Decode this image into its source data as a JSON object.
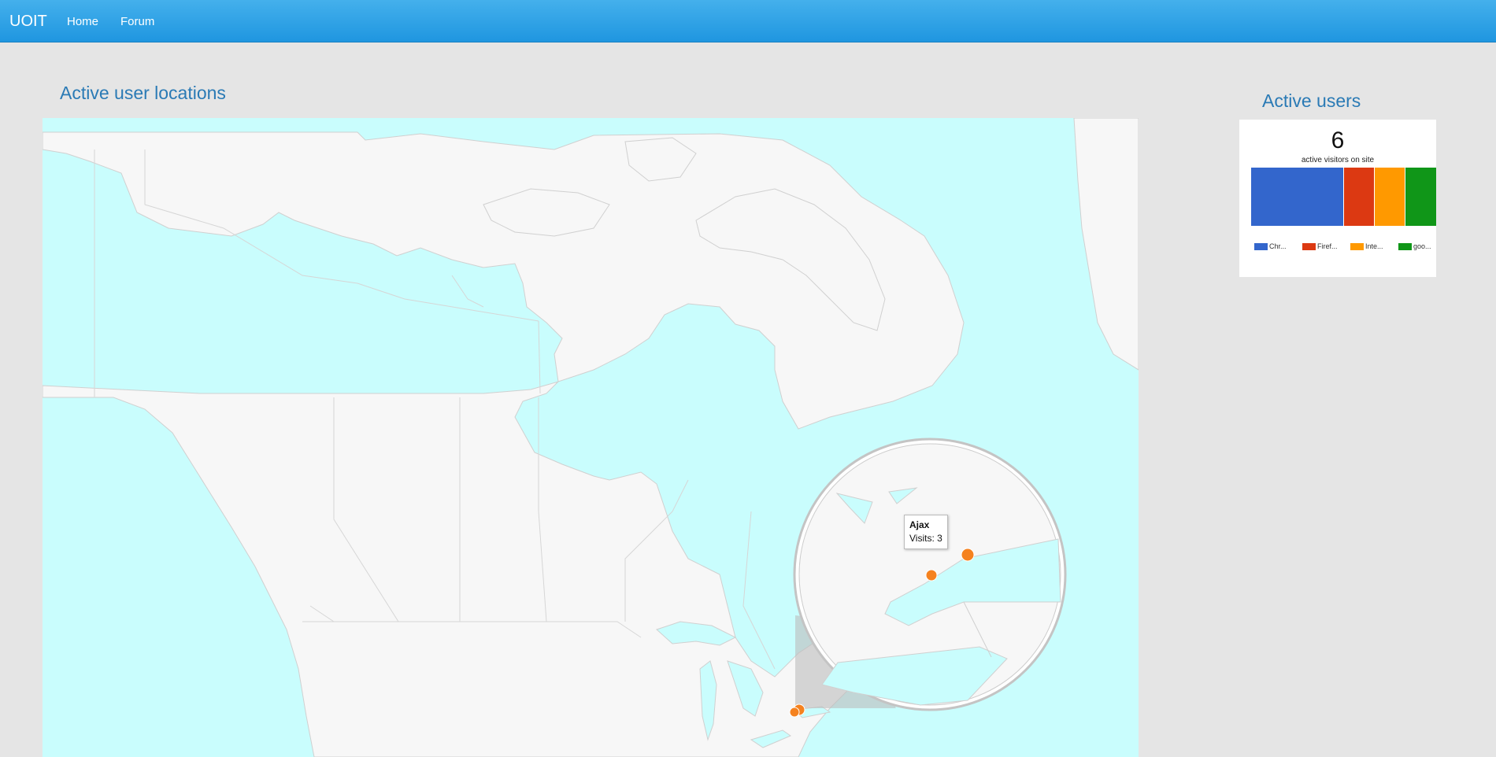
{
  "navbar": {
    "brand": "UOIT",
    "links": [
      {
        "label": "Home"
      },
      {
        "label": "Forum"
      }
    ]
  },
  "map": {
    "title": "Active user locations",
    "markers": [
      {
        "city": "Ajax",
        "visits_label": "Visits:",
        "visits": "3"
      }
    ],
    "colors": {
      "water": "#c9fdfd",
      "land": "#f7f7f7",
      "marker": "#f5821f"
    }
  },
  "active_users": {
    "title": "Active users",
    "count": "6",
    "count_label": "active visitors on site",
    "legend": [
      {
        "label": "Chr...",
        "color": "#3366cc",
        "fraction": 0.5
      },
      {
        "label": "Firef...",
        "color": "#dc3912",
        "fraction": 0.167
      },
      {
        "label": "Inte...",
        "color": "#ff9900",
        "fraction": 0.167
      },
      {
        "label": "goo...",
        "color": "#109618",
        "fraction": 0.166
      }
    ]
  }
}
